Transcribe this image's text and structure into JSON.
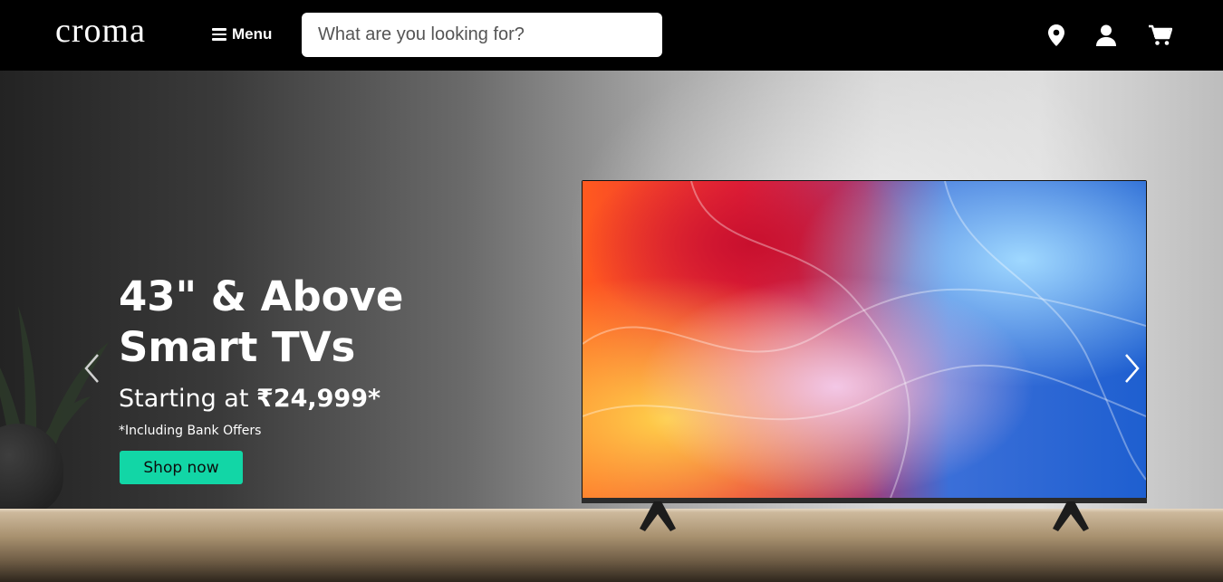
{
  "header": {
    "logo_text": "croma",
    "menu_label": "Menu",
    "search_placeholder": "What are you looking for?",
    "icons": [
      "location-pin-icon",
      "user-icon",
      "cart-icon"
    ]
  },
  "hero": {
    "title_line1": "43\" & Above",
    "title_line2": "Smart TVs",
    "price_prefix": "Starting at",
    "price_value": "₹24,999*",
    "note": "*Including Bank Offers",
    "cta_label": "Shop now"
  },
  "colors": {
    "header_bg": "#000000",
    "cta_bg": "#12d6a6",
    "text_light": "#ffffff"
  }
}
